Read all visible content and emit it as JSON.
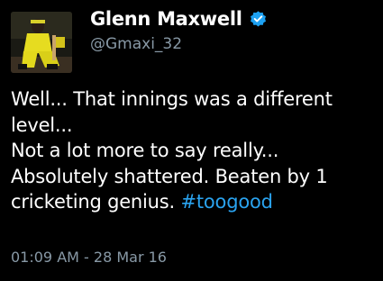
{
  "author": {
    "name": "Glenn Maxwell",
    "handle": "@Gmaxi_32",
    "verified": true,
    "avatar": "avatar-photo"
  },
  "tweet": {
    "lines": [
      "Well... That innings was a different",
      "level...",
      "Not a lot more to say really...",
      "Absolutely shattered. Beaten by 1",
      "cricketing genius. "
    ],
    "hashtag": "#toogood",
    "timestamp": "01:09 AM - 28 Mar 16"
  },
  "colors": {
    "background": "#000000",
    "text": "#ffffff",
    "muted": "#8899a6",
    "link": "#2aa3ef",
    "verified_badge": "#1da1f2"
  }
}
